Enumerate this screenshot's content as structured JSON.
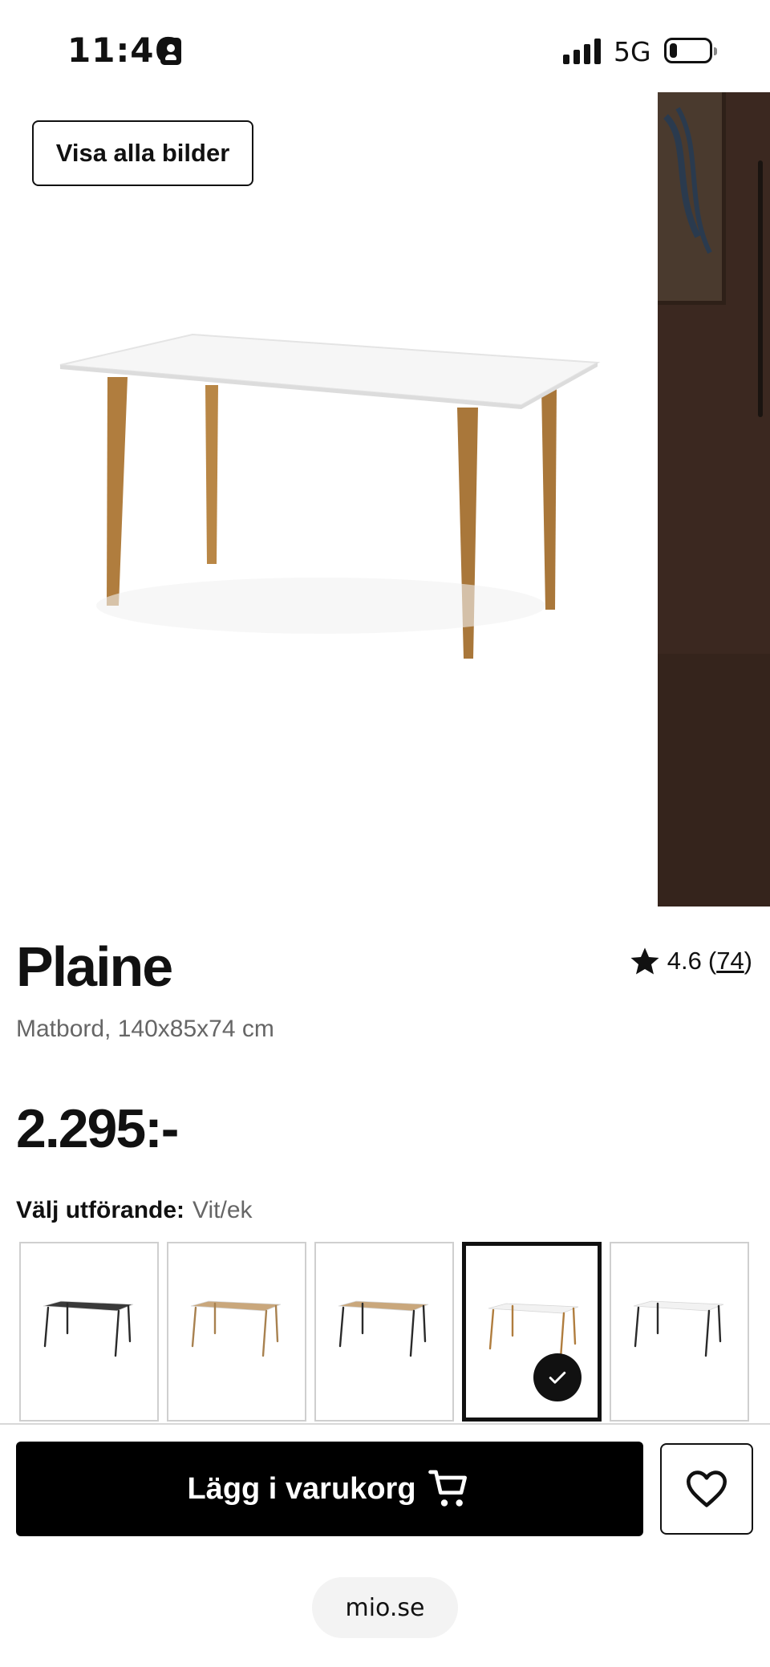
{
  "status_bar": {
    "time": "11:46",
    "network": "5G",
    "battery_level": 0.2
  },
  "gallery": {
    "show_all_label": "Visa alla bilder"
  },
  "product": {
    "name": "Plaine",
    "rating": "4.6",
    "review_count": "74",
    "subtitle": "Matbord, 140x85x74 cm",
    "price": "2.295:-"
  },
  "variant": {
    "label": "Välj utförande:",
    "selected_value": "Vit/ek",
    "options": [
      {
        "top": "#3a3a3a",
        "legs": "#2a2a2a",
        "selected": false
      },
      {
        "top": "#c9a77c",
        "legs": "#a8814f",
        "selected": false
      },
      {
        "top": "#c9a77c",
        "legs": "#2a2a2a",
        "selected": false
      },
      {
        "top": "#f2f2f2",
        "legs": "#b07d3e",
        "selected": true
      },
      {
        "top": "#f2f2f2",
        "legs": "#2a2a2a",
        "selected": false
      }
    ]
  },
  "actions": {
    "add_to_cart_label": "Lägg i varukorg"
  },
  "browser": {
    "url": "mio.se"
  },
  "colors": {
    "primary": "#000000",
    "muted_text": "#666666",
    "accent_wood": "#b07d3e"
  }
}
